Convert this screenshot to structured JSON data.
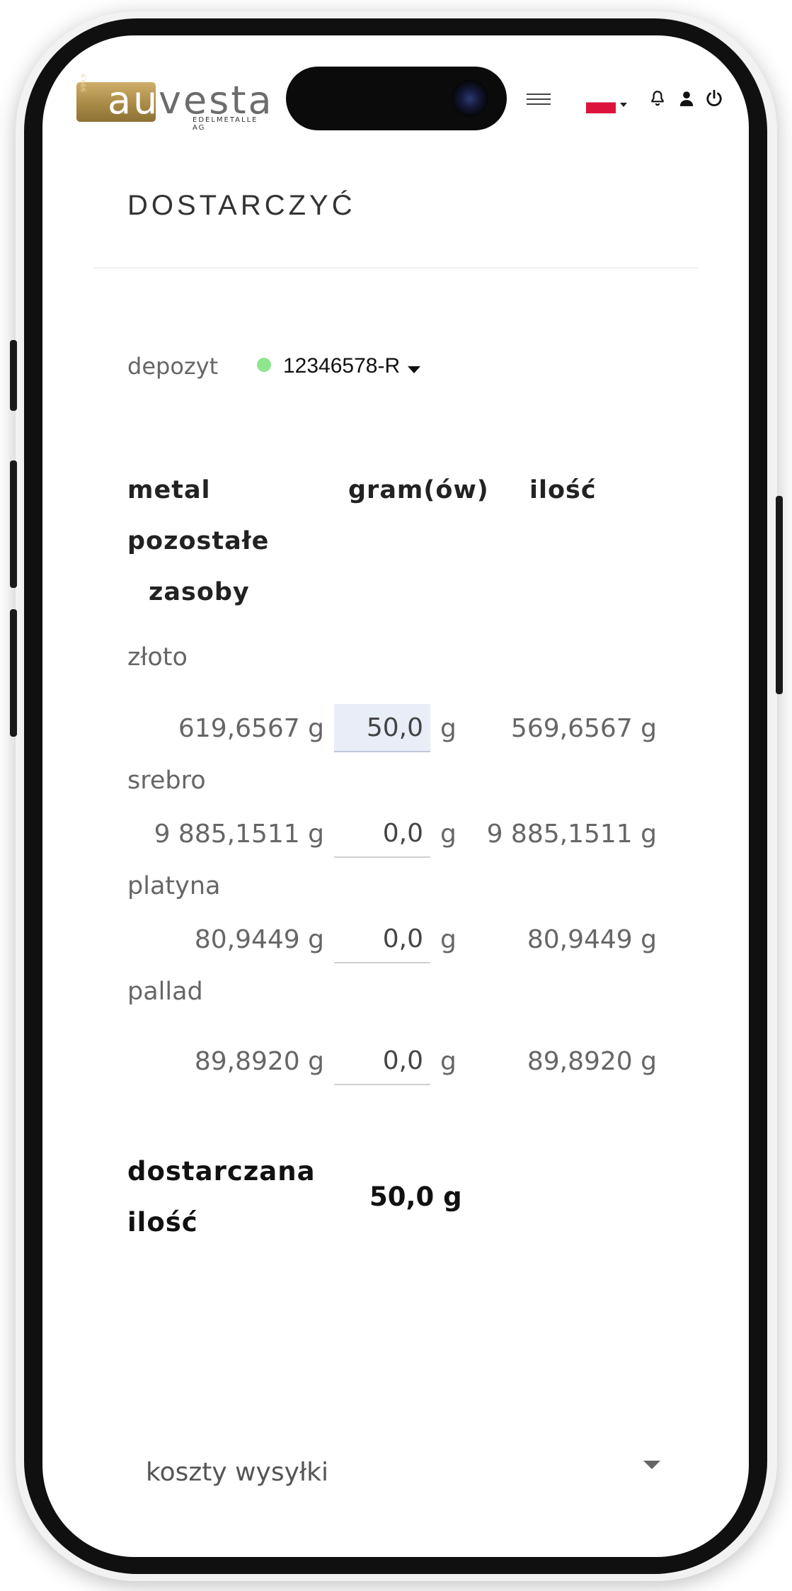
{
  "header": {
    "logo_au": "au",
    "logo_vesta": "vesta",
    "logo_subtitle": "EDELMETALLE AG",
    "logo_mark": "999,9",
    "language_flag": "pl-flag-icon",
    "icons": [
      "menu-icon",
      "bell-icon",
      "user-icon",
      "power-icon"
    ]
  },
  "page": {
    "title": "DOSTARCZYĆ"
  },
  "deposit": {
    "label": "depozyt",
    "value": "12346578-R",
    "status_color": "#8fe68f"
  },
  "table": {
    "headers": {
      "metal": "metal",
      "grams": "gram(ów)",
      "quantity": "ilość",
      "remaining_line1": "pozostałe",
      "remaining_line2": "zasoby"
    },
    "rows": [
      {
        "metal": "złoto",
        "available": "619,6567 g",
        "amount": "50,0",
        "unit": "g",
        "remaining": "569,6567 g"
      },
      {
        "metal": "srebro",
        "available": "9 885,1511 g",
        "amount": "0,0",
        "unit": "g",
        "remaining": "9 885,1511 g"
      },
      {
        "metal": "platyna",
        "available": "80,9449 g",
        "amount": "0,0",
        "unit": "g",
        "remaining": "80,9449 g"
      },
      {
        "metal": "pallad",
        "available": "89,8920 g",
        "amount": "0,0",
        "unit": "g",
        "remaining": "89,8920 g"
      }
    ]
  },
  "total": {
    "label": "dostarczana ilość",
    "value": "50,0 g"
  },
  "shipping": {
    "label": "koszty wysyłki"
  },
  "colors": {
    "flag_red": "#dc143c",
    "active_input_bg": "#e8edf8",
    "logo_gold": "#b8964f"
  }
}
